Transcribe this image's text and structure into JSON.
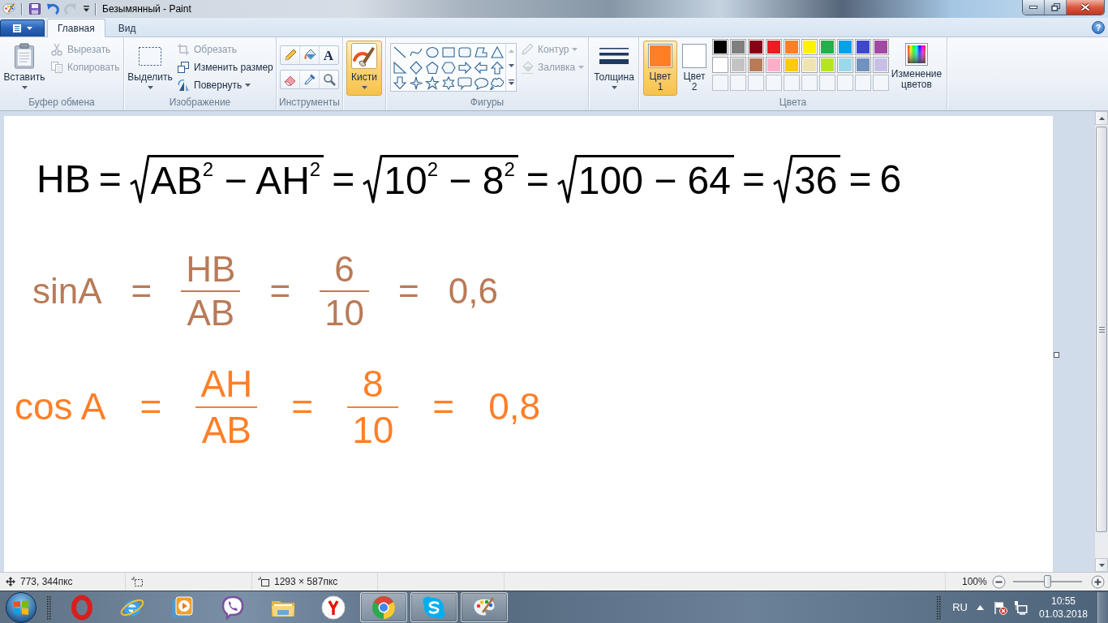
{
  "window": {
    "title": "Безымянный - Paint",
    "quick_access": [
      {
        "kind": "save",
        "disabled": false
      },
      {
        "kind": "undo",
        "disabled": false
      },
      {
        "kind": "redo",
        "disabled": true
      }
    ]
  },
  "ribbon": {
    "tabs": [
      {
        "label": "Главная",
        "selected": true
      },
      {
        "label": "Вид",
        "selected": false
      }
    ],
    "help": "?",
    "clipboard": {
      "label": "Буфер обмена",
      "paste": {
        "label": "Вставить"
      },
      "items": [
        {
          "kind": "cut",
          "label": "Вырезать",
          "disabled": true,
          "dropdown": false
        },
        {
          "kind": "copy",
          "label": "Копировать",
          "disabled": true,
          "dropdown": false
        }
      ]
    },
    "image": {
      "label": "Изображение",
      "select": {
        "label": "Выделить"
      },
      "items": [
        {
          "kind": "crop",
          "label": "Обрезать",
          "disabled": true,
          "dropdown": false
        },
        {
          "kind": "resize",
          "label": "Изменить размер",
          "disabled": false,
          "dropdown": false
        },
        {
          "kind": "rotate",
          "label": "Повернуть",
          "disabled": false,
          "dropdown": true
        }
      ]
    },
    "tools": {
      "label": "Инструменты",
      "items": [
        {
          "kind": "pencil"
        },
        {
          "kind": "fill"
        },
        {
          "kind": "text",
          "glyph": "A"
        },
        {
          "kind": "eraser"
        },
        {
          "kind": "picker"
        },
        {
          "kind": "magnifier"
        }
      ]
    },
    "brushes": {
      "label": "Кисти",
      "selected": true
    },
    "shapes": {
      "label": "Фигуры",
      "items": [
        {
          "kind": "outline",
          "label": "Контур",
          "disabled": true,
          "dropdown": true
        },
        {
          "kind": "fill",
          "label": "Заливка",
          "disabled": true,
          "dropdown": true
        }
      ]
    },
    "size": {
      "label": "Толщина"
    },
    "colors": {
      "label": "Цвета",
      "primary": {
        "label": "Цвет 1",
        "color": "#ff7f27",
        "selected": true
      },
      "secondary": {
        "label": "Цвет 2",
        "color": "#ffffff",
        "selected": false
      },
      "palette": [
        {
          "color": "#000000"
        },
        {
          "color": "#7f7f7f"
        },
        {
          "color": "#880015"
        },
        {
          "color": "#ed1c24"
        },
        {
          "color": "#ff7f27"
        },
        {
          "color": "#fff200"
        },
        {
          "color": "#22b14c"
        },
        {
          "color": "#00a2e8"
        },
        {
          "color": "#3f48cc"
        },
        {
          "color": "#a349a4"
        },
        {
          "color": "#ffffff"
        },
        {
          "color": "#c3c3c3"
        },
        {
          "color": "#b97a57"
        },
        {
          "color": "#ffaec9"
        },
        {
          "color": "#ffc90e"
        },
        {
          "color": "#efe4b0"
        },
        {
          "color": "#b5e61d"
        },
        {
          "color": "#99d9ea"
        },
        {
          "color": "#7092be"
        },
        {
          "color": "#c8bfe7"
        }
      ],
      "edit": {
        "label": "Изменение цветов"
      }
    }
  },
  "canvas": {
    "lines": [
      {
        "color": "#000000",
        "terms": [
          {
            "kind": "text",
            "text": "HB"
          },
          {
            "kind": "text",
            "text": "="
          },
          {
            "kind": "sqrt",
            "text": "AB$^{2}$ − AH$^{2}$"
          },
          {
            "kind": "text",
            "text": "="
          },
          {
            "kind": "sqrt",
            "text": "10$^{2}$ − 8$^{2}$"
          },
          {
            "kind": "text",
            "text": "="
          },
          {
            "kind": "sqrt",
            "text": "100 − 64"
          },
          {
            "kind": "text",
            "text": "="
          },
          {
            "kind": "sqrt",
            "text": "36"
          },
          {
            "kind": "text",
            "text": "="
          },
          {
            "kind": "text",
            "text": "6"
          }
        ]
      },
      {
        "color": "#b97a57",
        "terms": [
          {
            "kind": "text",
            "text": "sinA"
          },
          {
            "kind": "text",
            "text": "="
          },
          {
            "kind": "fraction",
            "numerator": "HB",
            "denominator": "AB"
          },
          {
            "kind": "text",
            "text": "="
          },
          {
            "kind": "fraction",
            "numerator": "6",
            "denominator": "10"
          },
          {
            "kind": "text",
            "text": "="
          },
          {
            "kind": "text",
            "text": "0,6"
          }
        ]
      },
      {
        "color": "#ff7f27",
        "terms": [
          {
            "kind": "text",
            "text": "cos A"
          },
          {
            "kind": "text",
            "text": "="
          },
          {
            "kind": "fraction",
            "numerator": "AH",
            "denominator": "AB"
          },
          {
            "kind": "text",
            "text": "="
          },
          {
            "kind": "fraction",
            "numerator": "8",
            "denominator": "10"
          },
          {
            "kind": "text",
            "text": "="
          },
          {
            "kind": "text",
            "text": "0,8"
          }
        ]
      }
    ]
  },
  "status_bar": {
    "cursor": "773, 344пкс",
    "canvas_size": "1293 × 587пкс",
    "zoom": "100%",
    "zoom_slider": {
      "level": 0.5
    }
  },
  "taskbar": {
    "apps": [
      {
        "kind": "ring",
        "open": false
      },
      {
        "kind": "orbit",
        "open": false
      },
      {
        "kind": "player",
        "open": false
      },
      {
        "kind": "phone",
        "open": false
      },
      {
        "kind": "folder",
        "open": false
      },
      {
        "kind": "ysign",
        "open": false
      },
      {
        "kind": "wheel",
        "open": true
      },
      {
        "kind": "cloud",
        "open": true
      },
      {
        "kind": "palette",
        "open": true
      }
    ],
    "tray": {
      "language": "RU",
      "time": "10:55",
      "date": "01.03.2018"
    }
  }
}
